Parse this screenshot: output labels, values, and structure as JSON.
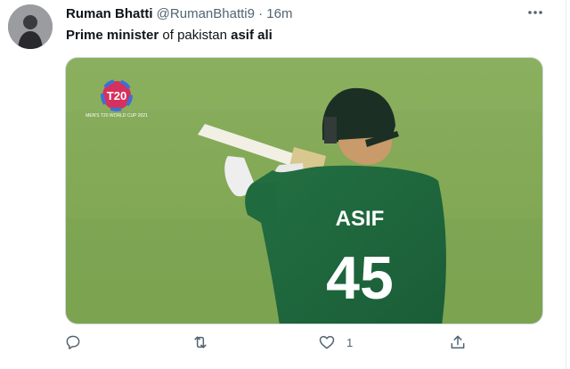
{
  "tweet": {
    "author_name": "Ruman Bhatti",
    "author_handle": "@RumanBhatti9",
    "separator": "·",
    "time": "16m",
    "text_parts": [
      {
        "text": "Prime minister",
        "bold": true
      },
      {
        "text": " of pakistan ",
        "bold": false
      },
      {
        "text": "asif ali",
        "bold": true
      }
    ]
  },
  "media": {
    "jersey_name": "ASIF",
    "jersey_number": "45",
    "logo_text": "T20",
    "logo_subtext": "MEN'S T20 WORLD CUP 2021"
  },
  "actions": {
    "reply_icon": "reply-icon",
    "retweet_icon": "retweet-icon",
    "like_icon": "heart-icon",
    "like_count": "1",
    "share_icon": "share-icon"
  },
  "colors": {
    "muted_text": "#536471",
    "pitch_green": "#7ea552",
    "jersey_green": "#1f6b3f",
    "border": "#cfd9de"
  }
}
